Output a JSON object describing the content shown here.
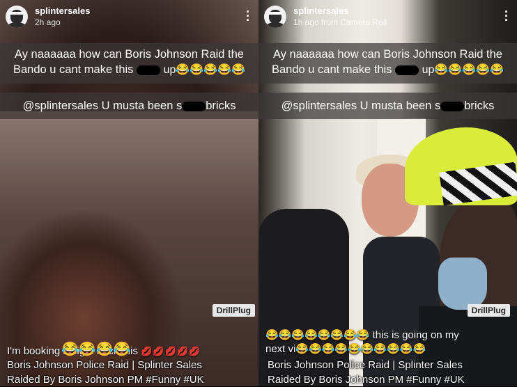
{
  "left": {
    "username": "splintersales",
    "time": "2h ago",
    "caption1": "Ay naaaaaa how can Boris Johnson Raid the Bando u cant make this",
    "caption1_end": "up😂😂😂😂😂",
    "caption2_start": "@splintersales U musta been s",
    "caption2_end": "bricks",
    "bottom_text": "I'm booking a flight back this",
    "bottom_emojis": "😂😂😂😂",
    "watermark": "DrillPlug"
  },
  "right": {
    "username": "splintersales",
    "time": "1h ago from Camera Roll",
    "caption1": "Ay naaaaaa how can Boris Johnson Raid the Bando u cant make this",
    "caption1_end": "up😂😂😂😂😂",
    "caption2_start": "@splintersales U musta been s",
    "caption2_end": "bricks",
    "bottom_line1": "😂😂😂😂😂😂😂😂 this is going on my",
    "bottom_line2": "next vi😂😂😂😂😂😂😂😂😂😂",
    "watermark": "DrillPlug"
  },
  "video_title": {
    "line1": "Boris Johnson Police Raid | Splinter Sales",
    "line2": "Raided By Boris Johnson PM #Funny #UK"
  },
  "icons": {
    "menu": "more-vertical-icon",
    "avatar": "avatar-icon"
  }
}
